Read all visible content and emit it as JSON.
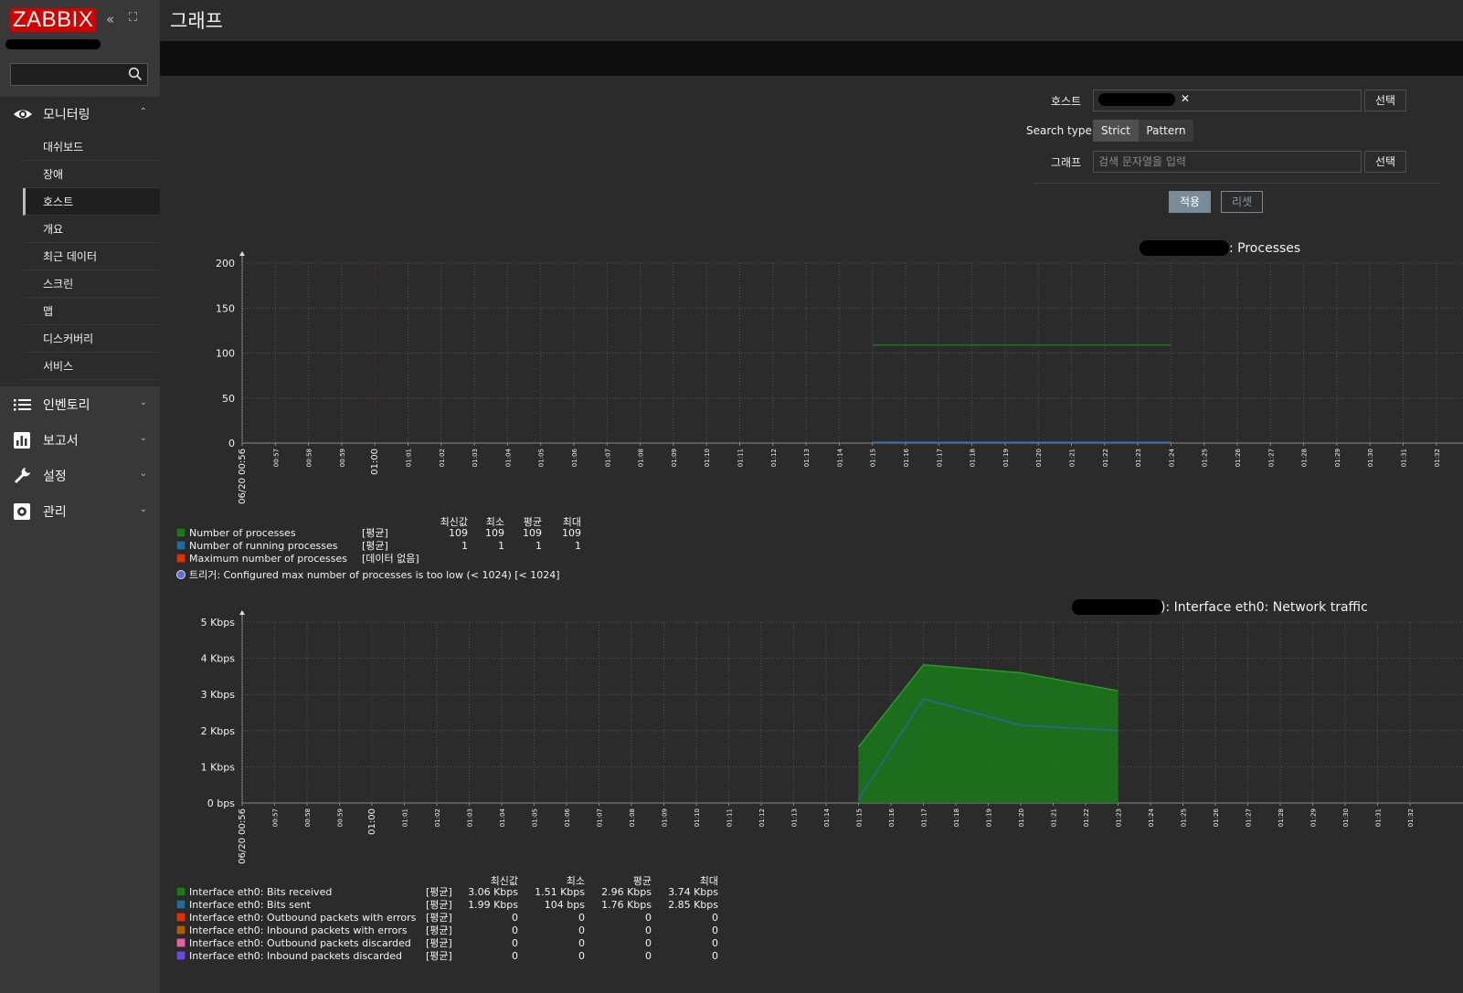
{
  "sidebar": {
    "logo": "ZABBIX",
    "collapse_icon": "«",
    "kiosk_icon": "⛶",
    "sections": [
      {
        "label": "모니터링",
        "icon": "eye-icon",
        "expanded": true,
        "items": [
          "대쉬보드",
          "장애",
          "호스트",
          "개요",
          "최근 데이터",
          "스크린",
          "맵",
          "디스커버리",
          "서비스"
        ],
        "active": "호스트"
      },
      {
        "label": "인벤토리",
        "icon": "list-icon",
        "expanded": false
      },
      {
        "label": "보고서",
        "icon": "bar-chart-icon",
        "expanded": false
      },
      {
        "label": "설정",
        "icon": "wrench-icon",
        "expanded": false
      },
      {
        "label": "관리",
        "icon": "gear-icon",
        "expanded": false
      }
    ]
  },
  "header": {
    "title": "그래프"
  },
  "filter": {
    "host_label": "호스트",
    "select_btn": "선택",
    "search_type_label": "Search type",
    "search_type_options": [
      "Strict",
      "Pattern"
    ],
    "search_type_selected": "Strict",
    "graph_label": "그래프",
    "graph_placeholder": "검색 문자열을 입력",
    "apply_btn": "적용",
    "reset_btn": "리셋"
  },
  "time_ticks": [
    "00:57",
    "00:58",
    "00:59",
    "01:00",
    "01:01",
    "01:02",
    "01:03",
    "01:04",
    "01:05",
    "01:06",
    "01:07",
    "01:08",
    "01:09",
    "01:10",
    "01:11",
    "01:12",
    "01:13",
    "01:14",
    "01:15",
    "01:16",
    "01:17",
    "01:18",
    "01:19",
    "01:20",
    "01:21",
    "01:22",
    "01:23",
    "01:24",
    "01:25",
    "01:26",
    "01:27",
    "01:28",
    "01:29",
    "01:30",
    "01:31",
    "01:32"
  ],
  "time_start": "06/20 00:56",
  "graphs": [
    {
      "title": ": Processes",
      "chart_data": {
        "type": "line",
        "ylim": [
          0,
          200
        ],
        "yticks": [
          "200",
          "150",
          "100",
          "50",
          "0"
        ],
        "series": [
          {
            "name": "Number of processes",
            "color": "#1a7a1a",
            "x": [
              "01:15",
              "01:24"
            ],
            "values": [
              109,
              109
            ]
          },
          {
            "name": "Number of running processes",
            "color": "#1f6b99",
            "x": [
              "01:15",
              "01:24"
            ],
            "values": [
              1,
              1
            ]
          },
          {
            "name": "Maximum number of processes",
            "color": "#e03000",
            "x": [],
            "values": []
          }
        ]
      },
      "legend_headers": [
        "최신값",
        "최소",
        "평균",
        "최대"
      ],
      "legend": [
        {
          "name": "Number of processes",
          "color": "#1a7a1a",
          "func": "[평균]",
          "vals": [
            "109",
            "109",
            "109",
            "109"
          ]
        },
        {
          "name": "Number of running processes",
          "color": "#1f6b99",
          "func": "[평균]",
          "vals": [
            "1",
            "1",
            "1",
            "1"
          ]
        },
        {
          "name": "Maximum number of processes",
          "color": "#e03000",
          "func": "[데이터 없음]",
          "vals": []
        }
      ],
      "trigger": "트리거: Configured max number of processes is too low (< 1024)     [< 1024]",
      "trigger_color": "#5a6edc"
    },
    {
      "title": "): Interface eth0: Network traffic",
      "chart_data": {
        "type": "area",
        "ylim": [
          0,
          5
        ],
        "yunit": "Kbps",
        "yticks": [
          "5 Kbps",
          "4 Kbps",
          "3 Kbps",
          "2 Kbps",
          "1 Kbps",
          "0 bps"
        ],
        "series": [
          {
            "name": "Interface eth0: Bits received",
            "color": "#1a7a1a",
            "x": [
              "01:15",
              "01:17",
              "01:20",
              "01:23"
            ],
            "values": [
              1.55,
              3.82,
              3.6,
              3.1
            ]
          },
          {
            "name": "Interface eth0: Bits sent",
            "color": "#1f6b99",
            "x": [
              "01:15",
              "01:17",
              "01:20",
              "01:23"
            ],
            "values": [
              0.1,
              2.88,
              2.15,
              2.0
            ]
          }
        ]
      },
      "legend_headers": [
        "최신값",
        "최소",
        "평균",
        "최대"
      ],
      "legend": [
        {
          "name": "Interface eth0: Bits received",
          "color": "#1a7a1a",
          "func": "[평균]",
          "vals": [
            "3.06 Kbps",
            "1.51 Kbps",
            "2.96 Kbps",
            "3.74 Kbps"
          ]
        },
        {
          "name": "Interface eth0: Bits sent",
          "color": "#1f6b99",
          "func": "[평균]",
          "vals": [
            "1.99 Kbps",
            "104 bps",
            "1.76 Kbps",
            "2.85 Kbps"
          ]
        },
        {
          "name": "Interface eth0: Outbound packets with errors",
          "color": "#e03000",
          "func": "[평균]",
          "vals": [
            "0",
            "0",
            "0",
            "0"
          ]
        },
        {
          "name": "Interface eth0: Inbound packets with errors",
          "color": "#b35a00",
          "func": "[평균]",
          "vals": [
            "0",
            "0",
            "0",
            "0"
          ]
        },
        {
          "name": "Interface eth0: Outbound packets discarded",
          "color": "#e060a0",
          "func": "[평균]",
          "vals": [
            "0",
            "0",
            "0",
            "0"
          ]
        },
        {
          "name": "Interface eth0: Inbound packets discarded",
          "color": "#6a4ad8",
          "func": "[평균]",
          "vals": [
            "0",
            "0",
            "0",
            "0"
          ]
        }
      ]
    }
  ]
}
